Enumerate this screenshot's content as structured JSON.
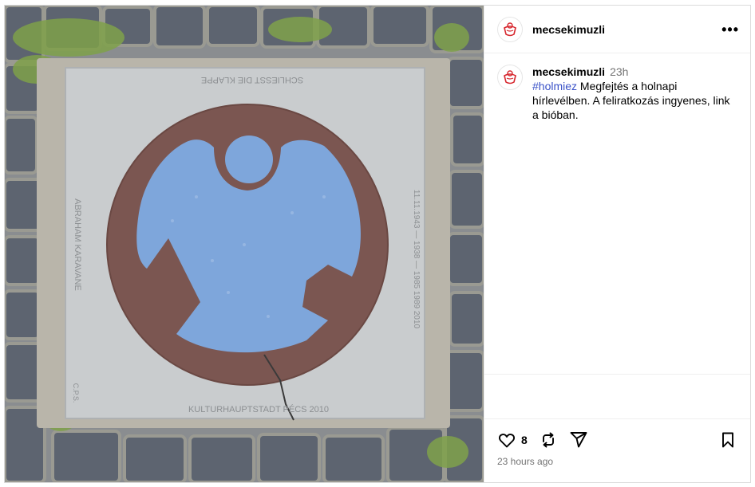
{
  "post": {
    "username": "mecsekimuzli",
    "more_label": "•••",
    "caption": {
      "username": "mecsekimuzli",
      "time": "23h",
      "hashtag": "#holmiez",
      "text": " Megfejtés a holnapi hírlevélben. A feliratkozás ingyenes, link a bióban."
    },
    "likes_count": "8",
    "timestamp": "23 hours ago"
  },
  "photo": {
    "plaque_top_text": "SCHLIESST DIE KLAPPE",
    "plaque_left_text": "ABRAHAM KARAVANE",
    "plaque_right_text": "11.11.1943 — 1938 — 1985  1989 2010",
    "plaque_bottom_text": "KULTURHAUPTSTADT PÉCS 2010",
    "plaque_corner_text": "C.P.S.",
    "colors": {
      "stone_plate": "#c9ccce",
      "ring": "#7b5651",
      "angel": "#7ea6db",
      "cobble": "#5d6470"
    }
  },
  "icons": {
    "avatar": "mascot-avatar-icon",
    "like": "heart-icon",
    "repost": "repost-icon",
    "share": "paper-plane-icon",
    "save": "bookmark-icon"
  }
}
